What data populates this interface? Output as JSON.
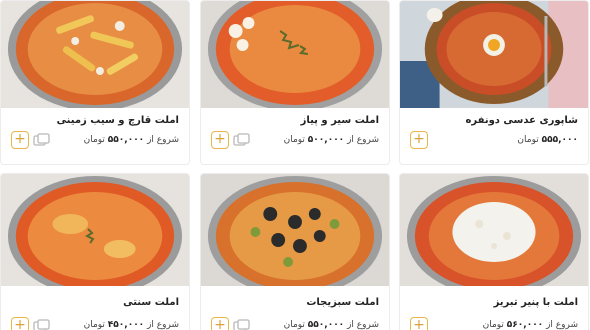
{
  "cards": [
    {
      "title": "املت قارچ و سیب زمینی",
      "price_prefix": "شروع از",
      "price": "۵۵۰,۰۰۰",
      "currency": "تومان"
    },
    {
      "title": "املت سیر و پیاز",
      "price_prefix": "شروع از",
      "price": "۵۰۰,۰۰۰",
      "currency": "تومان"
    },
    {
      "title": "شاپوری عدسی دونفره",
      "price_prefix": "",
      "price": "۵۵۵,۰۰۰",
      "currency": "تومان"
    },
    {
      "title": "املت سنتی",
      "price_prefix": "شروع از",
      "price": "۴۵۰,۰۰۰",
      "currency": "تومان"
    },
    {
      "title": "املت سبزیجات",
      "price_prefix": "شروع از",
      "price": "۵۵۰,۰۰۰",
      "currency": "تومان"
    },
    {
      "title": "املت با پنیر تبریز",
      "price_prefix": "شروع از",
      "price": "۵۶۰,۰۰۰",
      "currency": "تومان"
    }
  ],
  "add_label": "+",
  "icons": {
    "add": "plus-icon",
    "compare": "compare-icon"
  },
  "colors": {
    "accent": "#e8b84a",
    "pan": "#8c8c8c",
    "omelet": "#e0742a"
  }
}
